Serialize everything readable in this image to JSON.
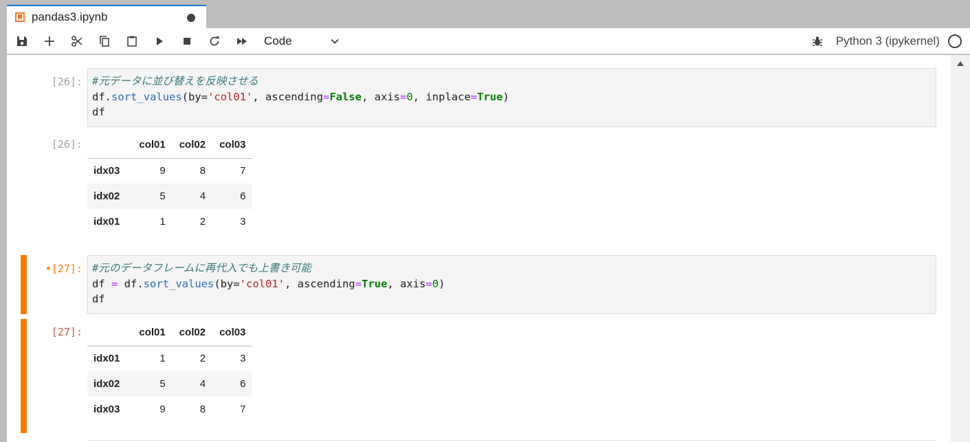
{
  "tab": {
    "title": "pandas3.ipynb"
  },
  "toolbar": {
    "buttons": [
      {
        "name": "save",
        "icon": "save-icon"
      },
      {
        "name": "insert-cell",
        "icon": "plus-icon"
      },
      {
        "name": "cut",
        "icon": "scissors-icon"
      },
      {
        "name": "copy",
        "icon": "copy-icon"
      },
      {
        "name": "paste",
        "icon": "paste-icon"
      },
      {
        "name": "run",
        "icon": "play-icon"
      },
      {
        "name": "interrupt",
        "icon": "stop-icon"
      },
      {
        "name": "restart",
        "icon": "refresh-icon"
      },
      {
        "name": "restart-run-all",
        "icon": "fast-forward-icon"
      }
    ],
    "cell_type": "Code",
    "kernel_name": "Python 3 (ipykernel)"
  },
  "cells": [
    {
      "in_prompt": "[26]:",
      "out_prompt": "[26]:",
      "code": {
        "line1_comment": "#元データに並び替えを反映させる",
        "line2": {
          "a": "df.",
          "fn": "sort_values",
          "b": "(by=",
          "str": "'col01'",
          "c": ", ascending",
          "eq1": "=",
          "kw1": "False",
          "d": ", axis",
          "eq2": "=",
          "num": "0",
          "e": ", inplace",
          "eq3": "=",
          "kw2": "True",
          "f": ")"
        },
        "line3": "df"
      },
      "table": {
        "columns": [
          "col01",
          "col02",
          "col03"
        ],
        "rows": [
          {
            "index": "idx03",
            "values": [
              "9",
              "8",
              "7"
            ]
          },
          {
            "index": "idx02",
            "values": [
              "5",
              "4",
              "6"
            ]
          },
          {
            "index": "idx01",
            "values": [
              "1",
              "2",
              "3"
            ]
          }
        ]
      }
    },
    {
      "in_prompt": "•[27]:",
      "out_prompt": "[27]:",
      "code": {
        "line1_comment": "#元のデータフレームに再代入でも上書き可能",
        "line2": {
          "a": "df ",
          "op": "=",
          "b": " df.",
          "fn": "sort_values",
          "c": "(by=",
          "str": "'col01'",
          "d": ", ascending",
          "eq1": "=",
          "kw1": "True",
          "e": ", axis",
          "eq2": "=",
          "num": "0",
          "f": ")"
        },
        "line3": "df"
      },
      "table": {
        "columns": [
          "col01",
          "col02",
          "col03"
        ],
        "rows": [
          {
            "index": "idx01",
            "values": [
              "1",
              "2",
              "3"
            ]
          },
          {
            "index": "idx02",
            "values": [
              "5",
              "4",
              "6"
            ]
          },
          {
            "index": "idx03",
            "values": [
              "9",
              "8",
              "7"
            ]
          }
        ]
      }
    }
  ],
  "colors": {
    "accent_tab": "#1976d2",
    "active_cell": "#f57c00",
    "code_bg": "#f5f5f5"
  }
}
